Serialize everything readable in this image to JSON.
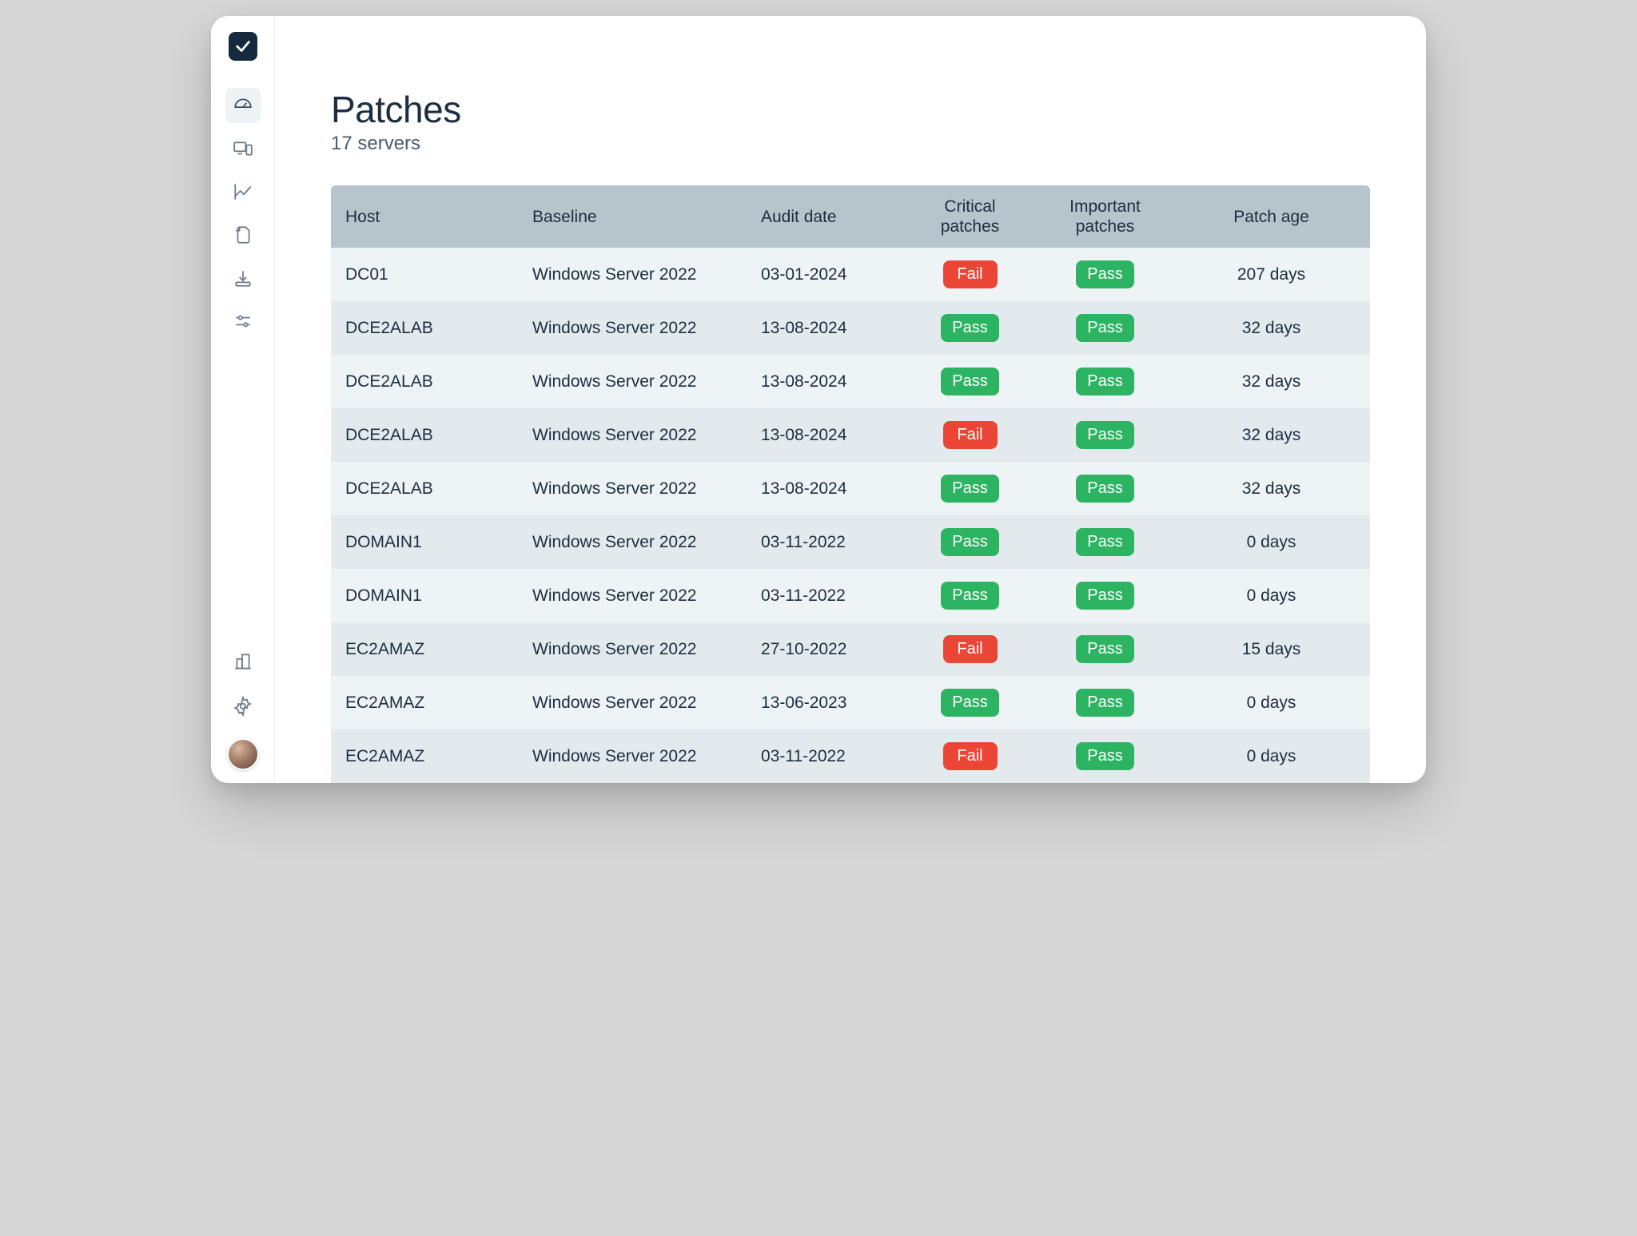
{
  "page": {
    "title": "Patches",
    "subtitle": "17 servers"
  },
  "table": {
    "headers": {
      "host": "Host",
      "baseline": "Baseline",
      "audit": "Audit date",
      "critical_l1": "Critical",
      "critical_l2": "patches",
      "important_l1": "Important",
      "important_l2": "patches",
      "age": "Patch age"
    },
    "rows": [
      {
        "host": "DC01",
        "baseline": "Windows Server 2022",
        "audit": "03-01-2024",
        "critical": "Fail",
        "important": "Pass",
        "age": "207 days"
      },
      {
        "host": "DCE2ALAB",
        "baseline": "Windows Server 2022",
        "audit": "13-08-2024",
        "critical": "Pass",
        "important": "Pass",
        "age": "32 days"
      },
      {
        "host": "DCE2ALAB",
        "baseline": "Windows Server 2022",
        "audit": "13-08-2024",
        "critical": "Pass",
        "important": "Pass",
        "age": "32 days"
      },
      {
        "host": "DCE2ALAB",
        "baseline": "Windows Server 2022",
        "audit": "13-08-2024",
        "critical": "Fail",
        "important": "Pass",
        "age": "32 days"
      },
      {
        "host": "DCE2ALAB",
        "baseline": "Windows Server 2022",
        "audit": "13-08-2024",
        "critical": "Pass",
        "important": "Pass",
        "age": "32 days"
      },
      {
        "host": "DOMAIN1",
        "baseline": "Windows Server 2022",
        "audit": "03-11-2022",
        "critical": "Pass",
        "important": "Pass",
        "age": "0 days"
      },
      {
        "host": "DOMAIN1",
        "baseline": "Windows Server 2022",
        "audit": "03-11-2022",
        "critical": "Pass",
        "important": "Pass",
        "age": "0 days"
      },
      {
        "host": "EC2AMAZ",
        "baseline": "Windows Server 2022",
        "audit": "27-10-2022",
        "critical": "Fail",
        "important": "Pass",
        "age": "15 days"
      },
      {
        "host": "EC2AMAZ",
        "baseline": "Windows Server 2022",
        "audit": "13-06-2023",
        "critical": "Pass",
        "important": "Pass",
        "age": "0 days"
      },
      {
        "host": "EC2AMAZ",
        "baseline": "Windows Server 2022",
        "audit": "03-11-2022",
        "critical": "Fail",
        "important": "Pass",
        "age": "0 days"
      }
    ]
  },
  "badges": {
    "pass": "Pass",
    "fail": "Fail"
  }
}
